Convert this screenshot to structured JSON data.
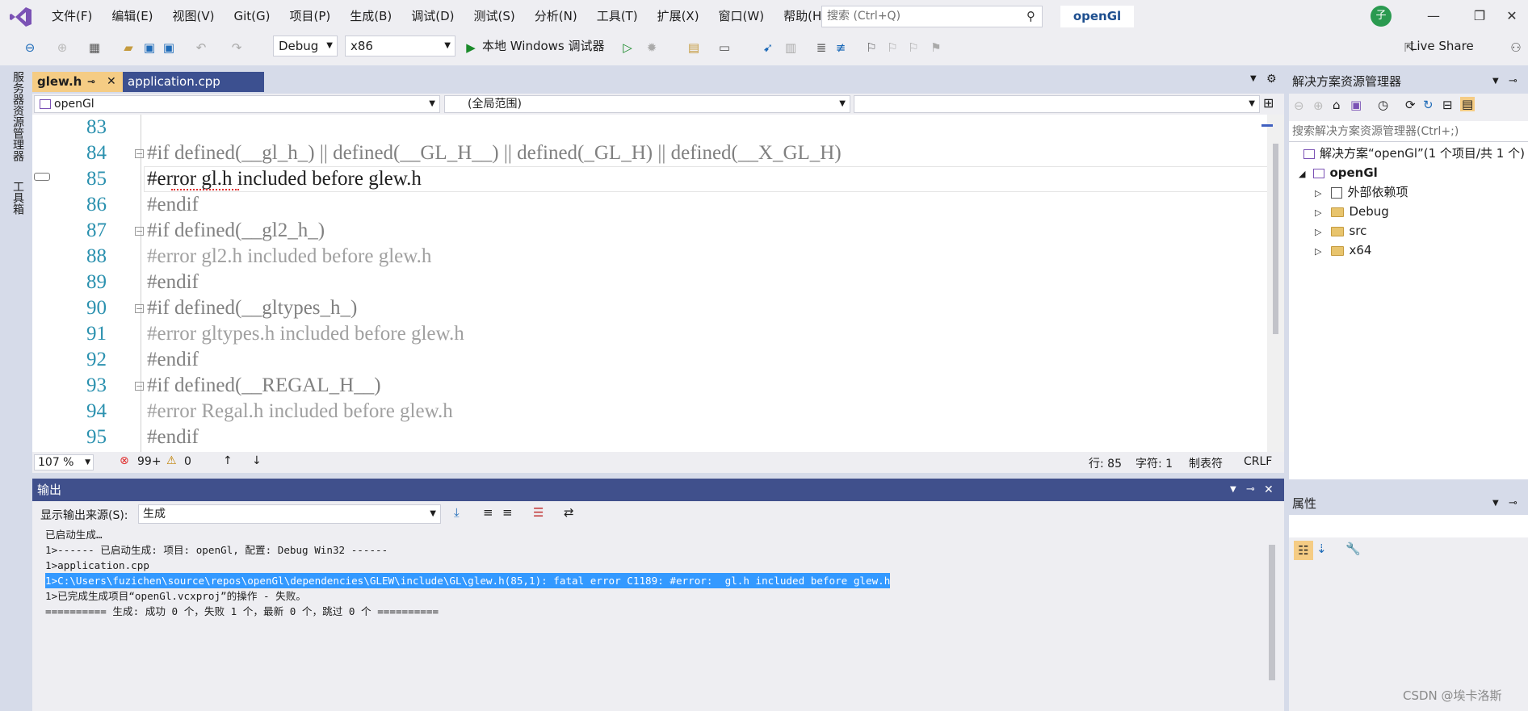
{
  "menu": {
    "items": [
      "文件(F)",
      "编辑(E)",
      "视图(V)",
      "Git(G)",
      "项目(P)",
      "生成(B)",
      "调试(D)",
      "测试(S)",
      "分析(N)",
      "工具(T)",
      "扩展(X)",
      "窗口(W)",
      "帮助(H)"
    ],
    "search_placeholder": "搜索 (Ctrl+Q)",
    "project_title": "openGl",
    "avatar": "子"
  },
  "toolbar": {
    "config": "Debug",
    "platform": "x86",
    "run_label": "本地 Windows 调试器",
    "live_share": "Live Share"
  },
  "leftrail": {
    "server_explorer": "服务器资源管理器",
    "toolbox": "工具箱"
  },
  "editor": {
    "tabs": [
      "glew.h",
      "application.cpp"
    ],
    "nav_project": "openGl",
    "nav_scope": "(全局范围)",
    "line_numbers": [
      "83",
      "84",
      "85",
      "86",
      "87",
      "88",
      "89",
      "90",
      "91",
      "92",
      "93",
      "94",
      "95"
    ],
    "lines": [
      "",
      "#if defined(__gl_h_) || defined(__GL_H__) || defined(_GL_H) || defined(__X_GL_H)",
      "#error gl.h included before glew.h",
      "#endif",
      "#if defined(__gl2_h_)",
      "#error gl2.h included before glew.h",
      "#endif",
      "#if defined(__gltypes_h_)",
      "#error gltypes.h included before glew.h",
      "#endif",
      "#if defined(__REGAL_H__)",
      "#error Regal.h included before glew.h",
      "#endif"
    ],
    "status": {
      "zoom": "107 %",
      "errors": "99+",
      "warnings": "0",
      "line": "行: 85",
      "char": "字符: 1",
      "tabs": "制表符",
      "eol": "CRLF"
    }
  },
  "output": {
    "title": "输出",
    "source_label": "显示输出来源(S):",
    "source_value": "生成",
    "lines": [
      "已启动生成…",
      "1>------ 已启动生成: 项目: openGl, 配置: Debug Win32 ------",
      "1>application.cpp",
      "1>C:\\Users\\fuzichen\\source\\repos\\openGl\\dependencies\\GLEW\\include\\GL\\glew.h(85,1): fatal error C1189: #error:  gl.h included before glew.h",
      "1>已完成生成项目“openGl.vcxproj”的操作 - 失败。",
      "========== 生成: 成功 0 个，失败 1 个，最新 0 个，跳过 0 个 =========="
    ]
  },
  "solution_explorer": {
    "title": "解决方案资源管理器",
    "search_placeholder": "搜索解决方案资源管理器(Ctrl+;)",
    "solution": "解决方案“openGl”(1 个项目/共 1 个)",
    "project": "openGl",
    "children": [
      "外部依赖项",
      "Debug",
      "src",
      "x64"
    ]
  },
  "properties": {
    "title": "属性"
  },
  "watermark": "CSDN @埃卡洛斯"
}
